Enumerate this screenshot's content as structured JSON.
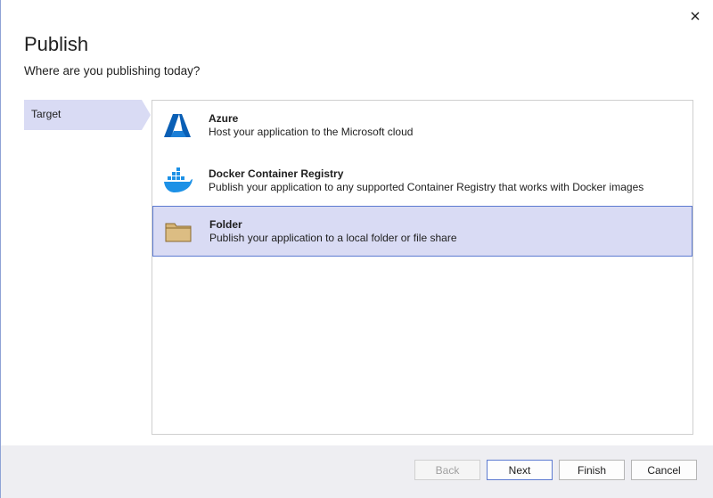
{
  "header": {
    "title": "Publish",
    "subtitle": "Where are you publishing today?"
  },
  "close": {
    "icon": "close-icon",
    "glyph": "✕"
  },
  "sidebar": {
    "items": [
      {
        "label": "Target",
        "selected": true
      }
    ]
  },
  "targets": [
    {
      "name": "Azure",
      "description": "Host your application to the Microsoft cloud",
      "icon": "azure-icon",
      "selected": false
    },
    {
      "name": "Docker Container Registry",
      "description": "Publish your application to any supported Container Registry that works with Docker images",
      "icon": "docker-icon",
      "selected": false
    },
    {
      "name": "Folder",
      "description": "Publish your application to a local folder or file share",
      "icon": "folder-icon",
      "selected": true
    }
  ],
  "footer": {
    "back_label": "Back",
    "next_label": "Next",
    "finish_label": "Finish",
    "cancel_label": "Cancel",
    "back_enabled": false
  },
  "colors": {
    "selection": "#d9dbf4",
    "selection_border": "#5d7bd1",
    "azure_blue": "#0a5fb5",
    "docker_blue": "#1d91e6",
    "folder_fill": "#d6b477",
    "footer_bg": "#eeeef2"
  }
}
